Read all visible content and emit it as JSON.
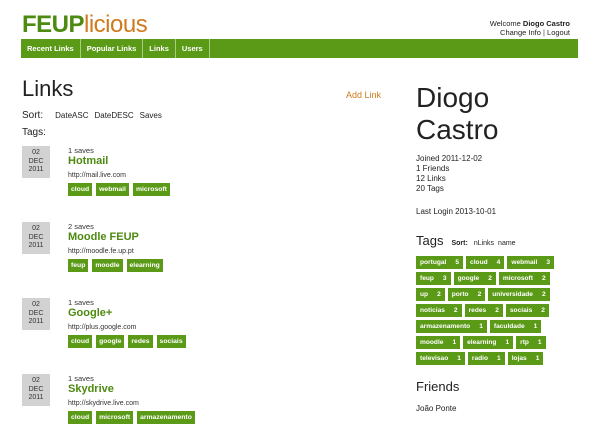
{
  "header": {
    "logo_main": "FEUP",
    "logo_suffix": "licious",
    "welcome_prefix": "Welcome",
    "user": "Diogo Castro",
    "change_info": "Change Info",
    "separator": "|",
    "logout": "Logout"
  },
  "nav": [
    "Recent Links",
    "Popular Links",
    "Links",
    "Users"
  ],
  "main": {
    "title": "Links",
    "add_link": "Add Link",
    "sort_label": "Sort:",
    "sort_options": [
      "DateASC",
      "DateDESC",
      "Saves"
    ],
    "tags_label": "Tags:",
    "entries": [
      {
        "day": "02",
        "month": "DEC",
        "year": "2011",
        "saves": "1 saves",
        "title": "Hotmail",
        "url": "http://mail.live.com",
        "tags": [
          "cloud",
          "webmail",
          "microsoft"
        ]
      },
      {
        "day": "02",
        "month": "DEC",
        "year": "2011",
        "saves": "2 saves",
        "title": "Moodle FEUP",
        "url": "http://moodle.fe.up.pt",
        "tags": [
          "feup",
          "moodle",
          "elearning"
        ]
      },
      {
        "day": "02",
        "month": "DEC",
        "year": "2011",
        "saves": "1 saves",
        "title": "Google+",
        "url": "http://plus.google.com",
        "tags": [
          "cloud",
          "google",
          "redes",
          "sociais"
        ]
      },
      {
        "day": "02",
        "month": "DEC",
        "year": "2011",
        "saves": "1 saves",
        "title": "Skydrive",
        "url": "http://skydrive.live.com",
        "tags": [
          "cloud",
          "microsoft",
          "armazenamento"
        ]
      }
    ]
  },
  "profile": {
    "name_line1": "Diogo",
    "name_line2": "Castro",
    "joined": "Joined 2011-12-02",
    "friends_count": "1 Friends",
    "links_count": "12 Links",
    "tags_count": "20 Tags",
    "last_login": "Last Login 2013-10-01",
    "tags_title": "Tags",
    "tags_sort_label": "Sort:",
    "tags_sort_options": [
      "nLinks",
      "name"
    ],
    "tag_cloud": [
      {
        "name": "portugal",
        "count": "5"
      },
      {
        "name": "cloud",
        "count": "4"
      },
      {
        "name": "webmail",
        "count": "3"
      },
      {
        "name": "feup",
        "count": "3"
      },
      {
        "name": "google",
        "count": "2"
      },
      {
        "name": "microsoft",
        "count": "2"
      },
      {
        "name": "up",
        "count": "2"
      },
      {
        "name": "porto",
        "count": "2"
      },
      {
        "name": "universidade",
        "count": "2"
      },
      {
        "name": "noticias",
        "count": "2"
      },
      {
        "name": "redes",
        "count": "2"
      },
      {
        "name": "sociais",
        "count": "2"
      },
      {
        "name": "armazenamento",
        "count": "1"
      },
      {
        "name": "faculdade",
        "count": "1"
      },
      {
        "name": "moodle",
        "count": "1"
      },
      {
        "name": "elearning",
        "count": "1"
      },
      {
        "name": "rtp",
        "count": "1"
      },
      {
        "name": "televisao",
        "count": "1"
      },
      {
        "name": "radio",
        "count": "1"
      },
      {
        "name": "lojas",
        "count": "1"
      }
    ],
    "friends_title": "Friends",
    "friends": [
      "João Ponte"
    ]
  }
}
